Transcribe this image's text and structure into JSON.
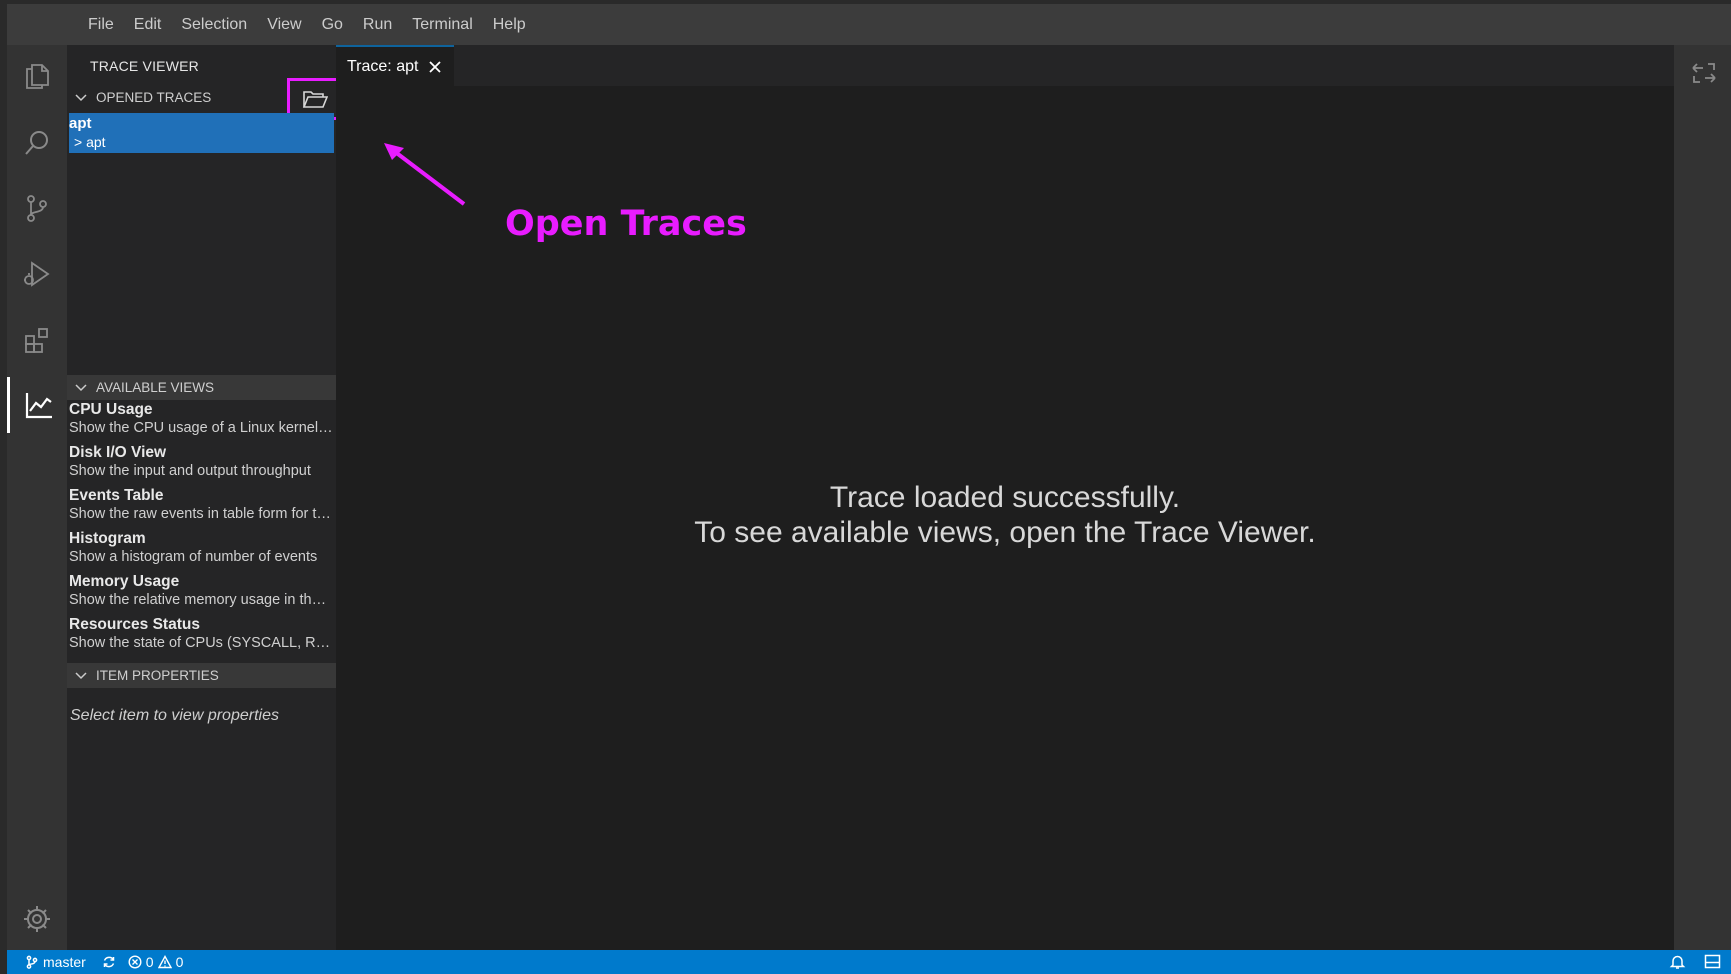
{
  "menu": [
    "File",
    "Edit",
    "Selection",
    "View",
    "Go",
    "Run",
    "Terminal",
    "Help"
  ],
  "sidebar": {
    "title": "TRACE VIEWER",
    "opened_traces": {
      "header": "OPENED TRACES",
      "items": [
        {
          "name": "apt",
          "sub": "> apt"
        }
      ]
    },
    "available_views": {
      "header": "AVAILABLE VIEWS",
      "items": [
        {
          "title": "CPU Usage",
          "desc": "Show the CPU usage of a Linux kernel trace"
        },
        {
          "title": "Disk I/O View",
          "desc": "Show the input and output throughput"
        },
        {
          "title": "Events Table",
          "desc": "Show the raw events in table form for the trace"
        },
        {
          "title": "Histogram",
          "desc": "Show a histogram of number of events"
        },
        {
          "title": "Memory Usage",
          "desc": "Show the relative memory usage in the trace"
        },
        {
          "title": "Resources Status",
          "desc": "Show the state of CPUs (SYSCALL, RUNNING)"
        }
      ]
    },
    "item_properties": {
      "header": "ITEM PROPERTIES",
      "empty": "Select item to view properties"
    }
  },
  "editor": {
    "tab_label": "Trace: apt",
    "message_line1": "Trace loaded successfully.",
    "message_line2": "To see available views, open the Trace Viewer."
  },
  "annotation": {
    "label": "Open Traces",
    "color": "#e81cff"
  },
  "statusbar": {
    "branch": "master",
    "errors": "0",
    "warnings": "0"
  },
  "colors": {
    "accent": "#007acc",
    "selection": "#2070b8",
    "highlight": "#e81cff"
  },
  "icons": [
    "explorer-icon",
    "search-icon",
    "source-control-icon",
    "run-debug-icon",
    "extensions-icon",
    "trace-viewer-icon",
    "settings-gear-icon",
    "open-folder-icon",
    "close-icon",
    "layout-icon",
    "git-branch-icon",
    "sync-icon",
    "error-icon",
    "warning-icon",
    "bell-icon",
    "panel-icon"
  ]
}
